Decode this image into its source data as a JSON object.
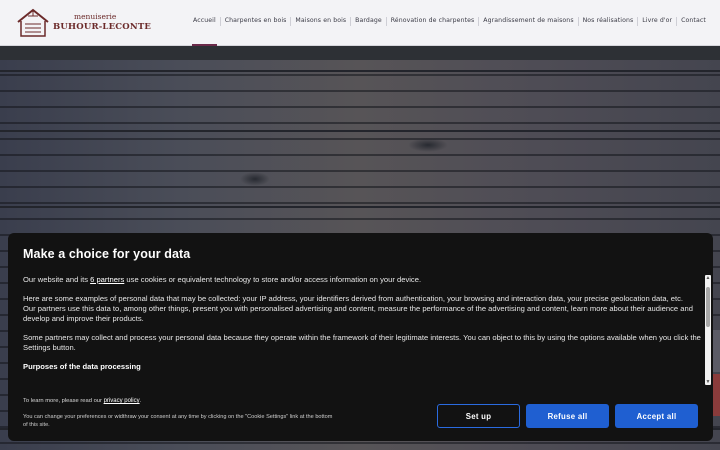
{
  "header": {
    "logo": {
      "line1": "menuiserie",
      "line2": "BUHOUR-LECONTE"
    },
    "nav": [
      {
        "label": "Accueil",
        "active": true
      },
      {
        "label": "Charpentes en bois",
        "active": false
      },
      {
        "label": "Maisons en bois",
        "active": false
      },
      {
        "label": "Bardage",
        "active": false
      },
      {
        "label": "Rénovation de charpentes",
        "active": false
      },
      {
        "label": "Agrandissement de maisons",
        "active": false
      },
      {
        "label": "Nos réalisations",
        "active": false
      },
      {
        "label": "Livre d'or",
        "active": false
      },
      {
        "label": "Contact",
        "active": false
      }
    ]
  },
  "consent": {
    "title": "Make a choice for your data",
    "intro_before": "Our website and its ",
    "intro_link": "6 partners",
    "intro_after": " use cookies or equivalent technology to store and/or access information on your device.",
    "examples": "Here are some examples of personal data that may be collected: your IP address, your identifiers derived from authentication, your browsing and interaction data, your precise geolocation data, etc.",
    "partners_use": "Our partners use this data to, among other things, present you with personalised advertising and content, measure the performance of the advertising and content, learn more about their audience and develop and improve their products.",
    "legitimate": "Some partners may collect and process your personal data because they operate within the framework of their legitimate interests. You can object to this by using the options available when you click the Settings button.",
    "purposes_heading": "Purposes of the data processing",
    "privacy_before": "To learn more, please read our ",
    "privacy_link": "privacy policy",
    "privacy_after": ".",
    "prefs_note": "You can change your preferences or widthraw your consent at any time by clicking on the \"Cookie Settings\" link at the bottom of this site.",
    "buttons": {
      "setup": "Set up",
      "refuse": "Refuse all",
      "accept": "Accept all"
    }
  },
  "colors": {
    "brand": "#6b2a2a",
    "accent_button": "#1f5fd1",
    "modal_bg": "#121212",
    "nav_active_underline": "#6b2a4a"
  },
  "icons": [
    "house-logo-icon",
    "scroll-up-icon",
    "scroll-down-icon"
  ]
}
